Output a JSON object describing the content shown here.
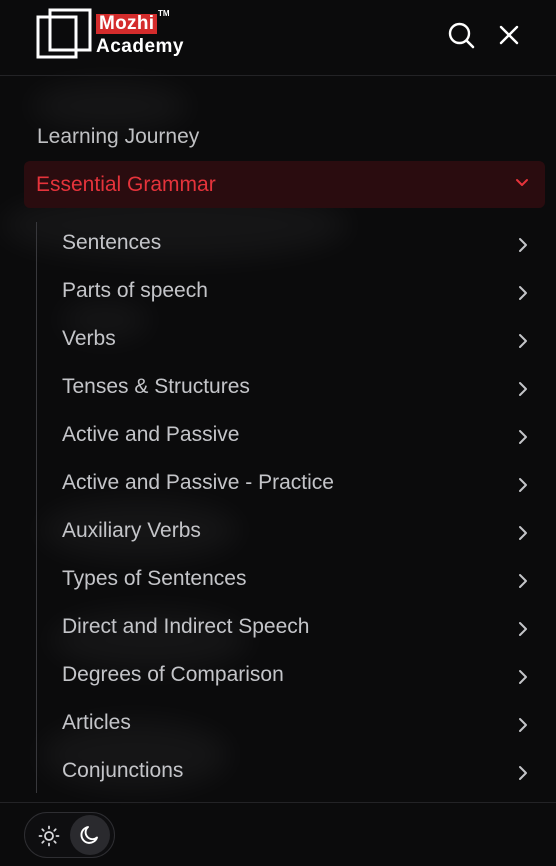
{
  "brand": {
    "name_top": "Mozhi",
    "trademark": "TM",
    "name_bottom": "Academy",
    "accent_color": "#d42c2c"
  },
  "header": {
    "search_icon": "search-icon",
    "close_icon": "close-icon"
  },
  "menu": {
    "section_label": "Learning Journey",
    "active_section": {
      "label": "Essential Grammar",
      "color": "#e5333b",
      "background": "#2a0c0f",
      "expanded": true
    },
    "items": [
      {
        "label": "Sentences"
      },
      {
        "label": "Parts of speech"
      },
      {
        "label": "Verbs"
      },
      {
        "label": "Tenses & Structures"
      },
      {
        "label": "Active and Passive"
      },
      {
        "label": "Active and Passive - Practice"
      },
      {
        "label": "Auxiliary Verbs"
      },
      {
        "label": "Types of Sentences"
      },
      {
        "label": "Direct and Indirect Speech"
      },
      {
        "label": "Degrees of Comparison"
      },
      {
        "label": "Articles"
      },
      {
        "label": "Conjunctions"
      }
    ]
  },
  "theme_toggle": {
    "options": [
      "light",
      "dark"
    ],
    "selected": "dark"
  }
}
